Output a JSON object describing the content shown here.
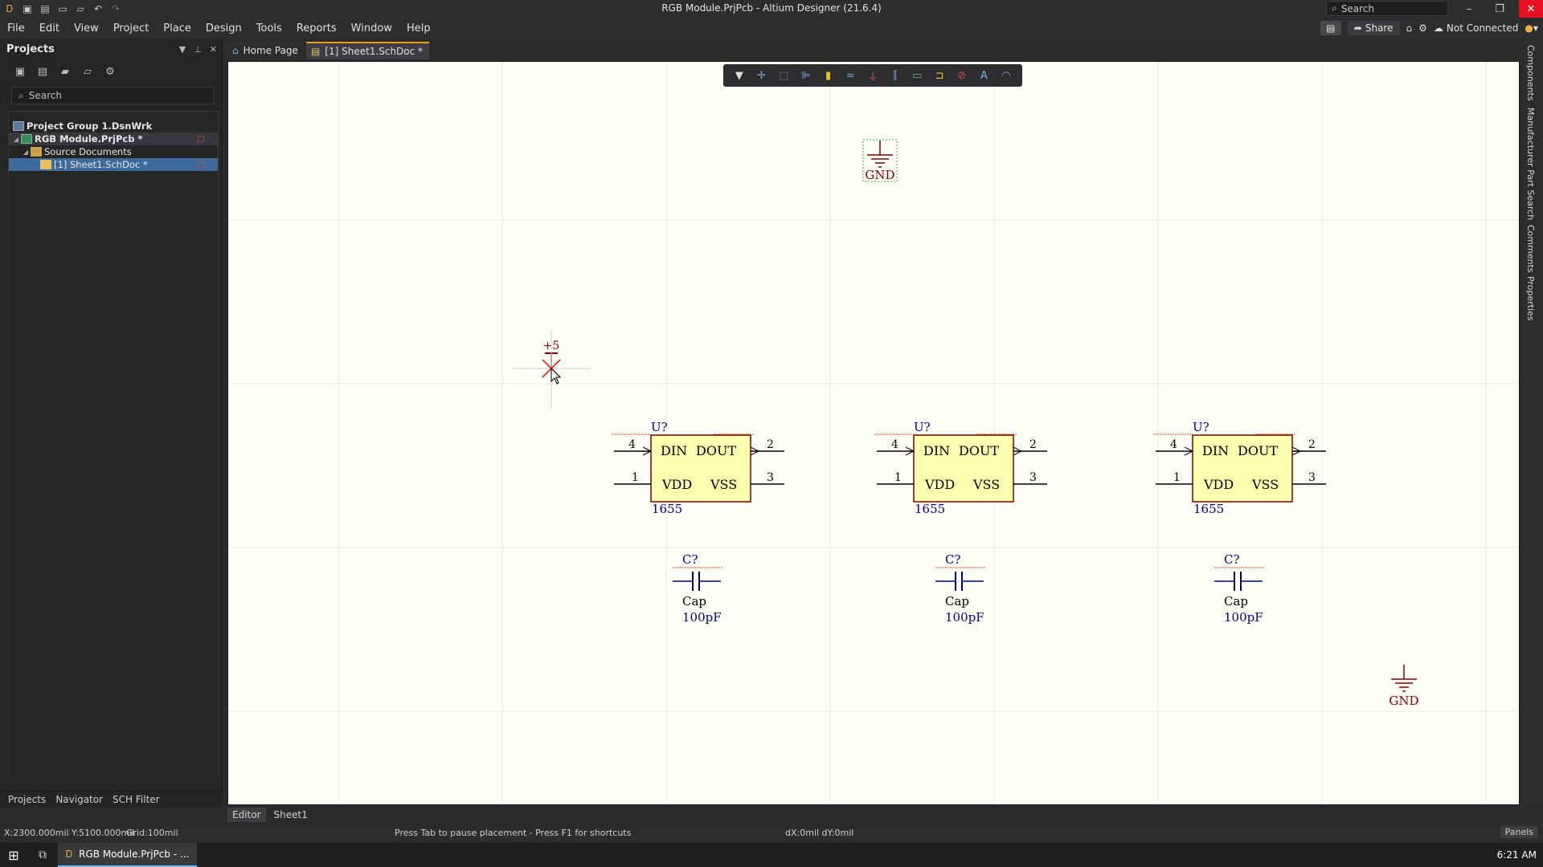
{
  "window": {
    "title": "RGB Module.PrjPcb - Altium Designer (21.6.4)",
    "search_placeholder": "Search",
    "min": "–",
    "max": "❐",
    "close": "✕"
  },
  "menu": [
    "File",
    "Edit",
    "View",
    "Project",
    "Place",
    "Design",
    "Tools",
    "Reports",
    "Window",
    "Help"
  ],
  "menubar_right": {
    "share": "Share",
    "connection": "Not Connected"
  },
  "projects_panel": {
    "title": "Projects",
    "search_placeholder": "Search",
    "tree": [
      {
        "label": "Project Group 1.DsnWrk",
        "depth": 0
      },
      {
        "label": "RGB Module.PrjPcb *",
        "depth": 1,
        "bold": true
      },
      {
        "label": "Source Documents",
        "depth": 2
      },
      {
        "label": "[1] Sheet1.SchDoc *",
        "depth": 3,
        "selected": true
      }
    ],
    "bottom_tabs": [
      "Projects",
      "Navigator",
      "SCH Filter"
    ]
  },
  "doc_tabs": [
    {
      "label": "Home Page"
    },
    {
      "label": "[1] Sheet1.SchDoc *",
      "active": true
    }
  ],
  "schematic": {
    "power_top": {
      "label": "GND"
    },
    "power_cursor": {
      "label": "+5"
    },
    "power_bottom": {
      "label": "GND"
    },
    "ics": [
      {
        "designator": "U?",
        "comment": "1655",
        "pin_in": "DIN",
        "pin_out": "DOUT",
        "pin_vdd": "VDD",
        "pin_vss": "VSS",
        "n_din": "4",
        "n_dout": "2",
        "n_vdd": "1",
        "n_vss": "3"
      },
      {
        "designator": "U?",
        "comment": "1655",
        "pin_in": "DIN",
        "pin_out": "DOUT",
        "pin_vdd": "VDD",
        "pin_vss": "VSS",
        "n_din": "4",
        "n_dout": "2",
        "n_vdd": "1",
        "n_vss": "3"
      },
      {
        "designator": "U?",
        "comment": "1655",
        "pin_in": "DIN",
        "pin_out": "DOUT",
        "pin_vdd": "VDD",
        "pin_vss": "VSS",
        "n_din": "4",
        "n_dout": "2",
        "n_vdd": "1",
        "n_vss": "3"
      }
    ],
    "caps": [
      {
        "designator": "C?",
        "comment": "Cap",
        "value": "100pF"
      },
      {
        "designator": "C?",
        "comment": "Cap",
        "value": "100pF"
      },
      {
        "designator": "C?",
        "comment": "Cap",
        "value": "100pF"
      }
    ]
  },
  "right_panels": [
    "Components",
    "Manufacturer Part Search",
    "Comments",
    "Properties"
  ],
  "editor_tabs": [
    "Editor",
    "Sheet1"
  ],
  "status": {
    "coords": "X:2300.000mil Y:5100.000mil",
    "grid": "Grid:100mil",
    "hint": "Press Tab to pause placement - Press F1 for shortcuts",
    "delta": "dX:0mil dY:0mil",
    "panels": "Panels"
  },
  "taskbar": {
    "app": "RGB Module.PrjPcb - ...",
    "clock": "6:21 AM"
  },
  "colors": {
    "sheet": "#fffef6",
    "component_fill": "#ffffb0",
    "component_stroke": "#800000",
    "wire": "#000080",
    "cursor": "#ff0000",
    "accent": "#f0a020"
  }
}
